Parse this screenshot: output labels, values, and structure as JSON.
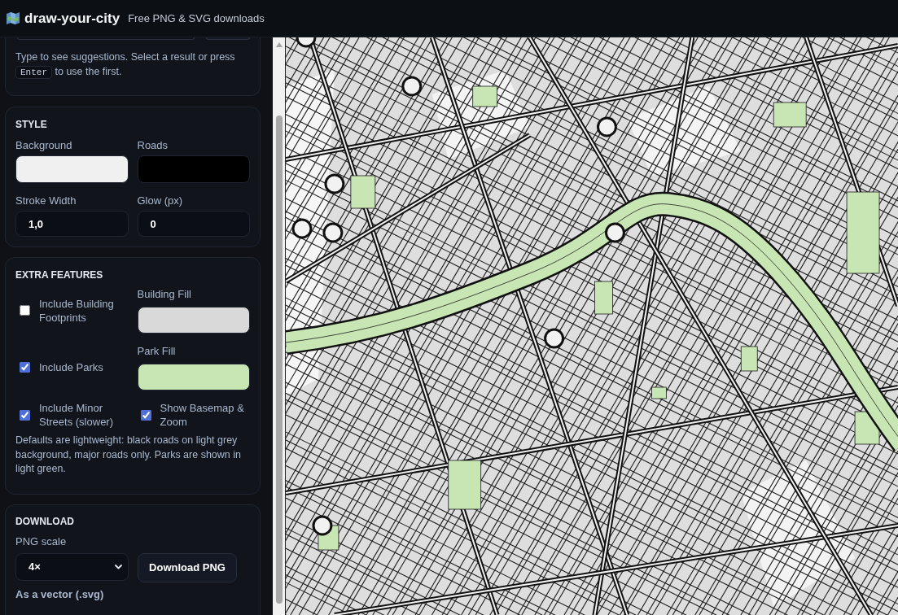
{
  "header": {
    "title": "draw-your-city",
    "tagline": "Free PNG & SVG downloads"
  },
  "search": {
    "hint_before": "Type to see suggestions. Select a result or press",
    "hint_key": "Enter",
    "hint_after": "to use the first."
  },
  "style": {
    "heading": "STYLE",
    "fields": [
      {
        "kind": "color",
        "label": "Background",
        "color": "#f0f0f0"
      },
      {
        "kind": "color",
        "label": "Roads",
        "color": "#000000"
      },
      {
        "kind": "number",
        "label": "Stroke Width",
        "value": "1,0"
      },
      {
        "kind": "number",
        "label": "Glow (px)",
        "value": "0"
      }
    ]
  },
  "extra_features": {
    "heading": "EXTRA FEATURES",
    "items": [
      {
        "kind": "checkbox",
        "label": "Include Building Footprints",
        "checked": false
      },
      {
        "kind": "color",
        "label": "Building Fill",
        "color": "#d9d9d9"
      },
      {
        "kind": "checkbox",
        "label": "Include Parks",
        "checked": true
      },
      {
        "kind": "color",
        "label": "Park Fill",
        "color": "#c8e6b4"
      },
      {
        "kind": "checkbox",
        "label": "Include Minor Streets (slower)",
        "checked": true
      },
      {
        "kind": "checkbox",
        "label": "Show Basemap & Zoom",
        "checked": true
      }
    ],
    "note": "Defaults are lightweight: black roads on light grey background, major roads only. Parks are shown in light green."
  },
  "download": {
    "heading": "DOWNLOAD",
    "scale_label": "PNG scale",
    "scale_value": "4×",
    "button": "Download PNG",
    "vector_label": "As a vector (.svg)"
  }
}
